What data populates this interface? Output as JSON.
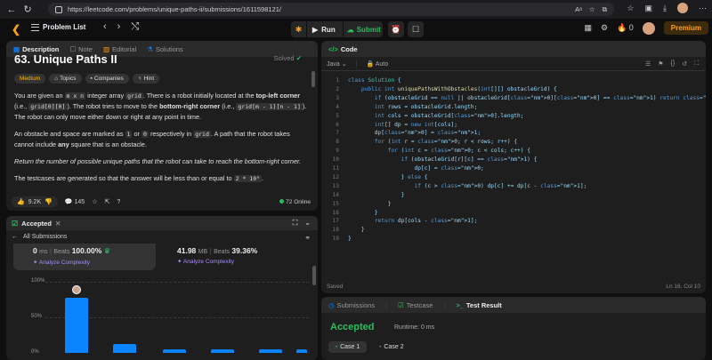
{
  "browser": {
    "url": "https://leetcode.com/problems/unique-paths-ii/submissions/1611598121/"
  },
  "appbar": {
    "problem_list": "Problem List",
    "run": "Run",
    "submit": "Submit",
    "streak": "0",
    "premium": "Premium"
  },
  "desc_tabs": [
    "Description",
    "Note",
    "Editorial",
    "Solutions"
  ],
  "problem": {
    "title": "63. Unique Paths II",
    "solved": "Solved",
    "chips": [
      "Medium",
      "Topics",
      "Companies",
      "Hint"
    ],
    "p1_a": "You are given an ",
    "p1_code1": "m x n",
    "p1_b": " integer array ",
    "p1_code2": "grid",
    "p1_c": ". There is a robot initially located at the ",
    "p1_bold1": "top-left corner",
    "p1_d": " (i.e., ",
    "p1_code3": "grid[0][0]",
    "p1_e": "). The robot tries to move to the ",
    "p1_bold2": "bottom-right corner",
    "p1_f": " (i.e., ",
    "p1_code4": "grid[m - 1][n - 1]",
    "p1_g": "). The robot can only move either down or right at any point in time.",
    "p2_a": "An obstacle and space are marked as ",
    "p2_code1": "1",
    "p2_b": " or ",
    "p2_code2": "0",
    "p2_c": " respectively in ",
    "p2_code3": "grid",
    "p2_d": ". A path that the robot takes cannot include ",
    "p2_bold": "any",
    "p2_e": " square that is an obstacle.",
    "p3": "Return the number of possible unique paths that the robot can take to reach the bottom-right corner.",
    "p4_a": "The testcases are generated so that the answer will be less than or equal to ",
    "p4_code": "2 * 10⁹",
    "p4_b": ".",
    "likes": "9.2K",
    "comments": "145",
    "online": "72 Online"
  },
  "accepted": {
    "title": "Accepted",
    "all_submissions": "All Submissions",
    "runtime_val": "0",
    "runtime_unit": "ms",
    "beats_label": "Beats",
    "runtime_beats": "100.00%",
    "memory_val": "41.98",
    "memory_unit": "MB",
    "memory_beats": "39.36%",
    "analyze": "Analyze Complexity",
    "y_labels": [
      "100%",
      "50%",
      "0%"
    ]
  },
  "chart_data": {
    "type": "bar",
    "ylim": [
      0,
      100
    ],
    "values": [
      78,
      12,
      5,
      5,
      5,
      5
    ]
  },
  "code_panel": {
    "title": "Code",
    "language": "Java",
    "mode": "Auto",
    "saved": "Saved",
    "position": "Ln 16, Col 10",
    "lines": [
      "class Solution {",
      "    public int uniquePathsWithObstacles(int[][] obstacleGrid) {",
      "        if (obstacleGrid == null || obstacleGrid[0][0] == 1) return 0;",
      "        int rows = obstacleGrid.length;",
      "        int cols = obstacleGrid[0].length;",
      "        int[] dp = new int[cols];",
      "        dp[0] = 1;",
      "        for (int r = 0; r < rows; r++) {",
      "            for (int c = 0; c < cols; c++) {",
      "                if (obstacleGrid[r][c] == 1) {",
      "                    dp[c] = 0;",
      "                } else {",
      "                    if (c > 0) dp[c] += dp[c - 1];",
      "                }",
      "            }",
      "        }",
      "        return dp[cols - 1];",
      "    }",
      "}"
    ]
  },
  "result": {
    "tabs": [
      "Submissions",
      "Testcase",
      "Test Result"
    ],
    "status": "Accepted",
    "runtime": "Runtime: 0 ms",
    "cases": [
      "Case 1",
      "Case 2"
    ]
  },
  "colors": {
    "accent": "#ffa116",
    "success": "#2cbb5d",
    "bar": "#0a84ff"
  }
}
